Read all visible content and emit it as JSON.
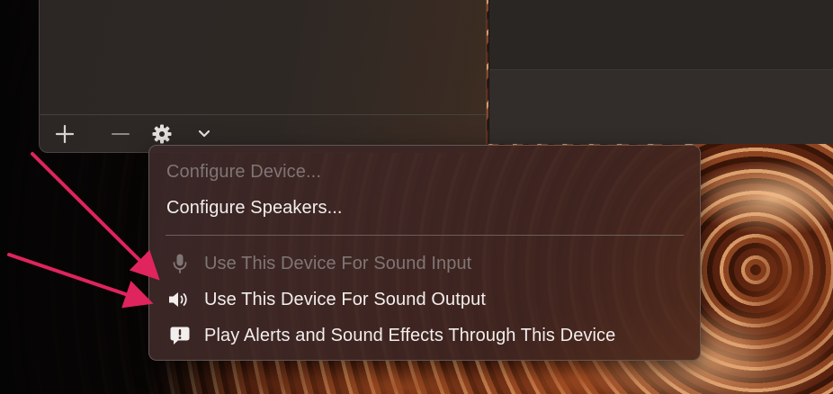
{
  "toolbar": {
    "add_icon": "plus-icon",
    "remove_icon": "minus-icon",
    "settings_icon": "gear-icon",
    "dropdown_icon": "chevron-down-icon"
  },
  "menu": {
    "configure_device": "Configure Device...",
    "configure_speakers": "Configure Speakers...",
    "sound_input": "Use This Device For Sound Input",
    "sound_output": "Use This Device For Sound Output",
    "alerts": "Play Alerts and Sound Effects Through This Device"
  },
  "colors": {
    "annotation_arrow": "#e0245e",
    "menu_text": "#f2eeec",
    "menu_text_disabled": "#7f7674"
  }
}
